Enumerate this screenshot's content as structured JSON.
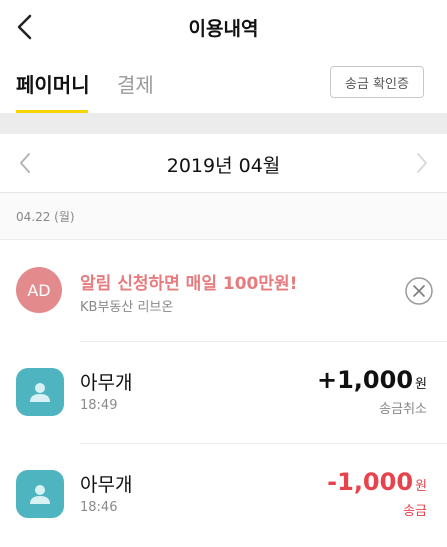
{
  "header": {
    "title": "이용내역"
  },
  "tabs": [
    {
      "label": "페이머니"
    },
    {
      "label": "결제"
    }
  ],
  "receipt_button": "송금 확인증",
  "month": {
    "label": "2019년 04월"
  },
  "date_header": "04.22 (월)",
  "ad": {
    "badge": "AD",
    "title": "알림 신청하면 매일 100만원!",
    "subtitle": "KB부동산 리브온"
  },
  "transactions": [
    {
      "name": "아무개",
      "time": "18:49",
      "amount": "+1,000",
      "unit": "원",
      "status": "송금취소",
      "amount_color": "#111111",
      "status_color": "#888888"
    },
    {
      "name": "아무개",
      "time": "18:46",
      "amount": "-1,000",
      "unit": "원",
      "status": "송금",
      "amount_color": "#e8434d",
      "status_color": "#e8434d"
    }
  ]
}
